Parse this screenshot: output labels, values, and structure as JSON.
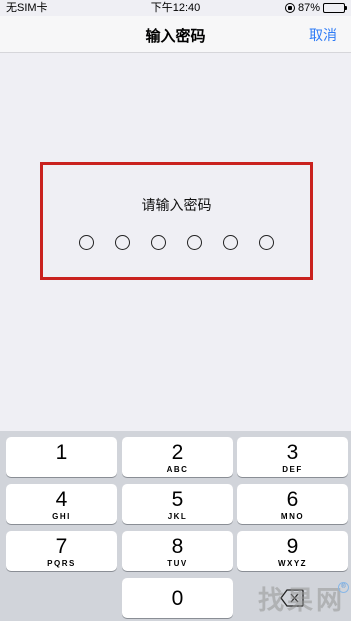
{
  "status_bar": {
    "carrier": "无SIM卡",
    "time": "下午12:40",
    "battery_percent": "87%",
    "battery_level": 0.87
  },
  "nav": {
    "title": "输入密码",
    "cancel_label": "取消",
    "accent_color": "#2f7cf6"
  },
  "passcode": {
    "prompt": "请输入密码",
    "digit_count": 6,
    "highlight_color": "#c9211e"
  },
  "keypad": {
    "keys": [
      {
        "num": "1",
        "letters": ""
      },
      {
        "num": "2",
        "letters": "ABC"
      },
      {
        "num": "3",
        "letters": "DEF"
      },
      {
        "num": "4",
        "letters": "GHI"
      },
      {
        "num": "5",
        "letters": "JKL"
      },
      {
        "num": "6",
        "letters": "MNO"
      },
      {
        "num": "7",
        "letters": "PQRS"
      },
      {
        "num": "8",
        "letters": "TUV"
      },
      {
        "num": "9",
        "letters": "WXYZ"
      },
      {
        "num": "0",
        "letters": ""
      }
    ]
  },
  "watermark": {
    "text": "找果网"
  }
}
